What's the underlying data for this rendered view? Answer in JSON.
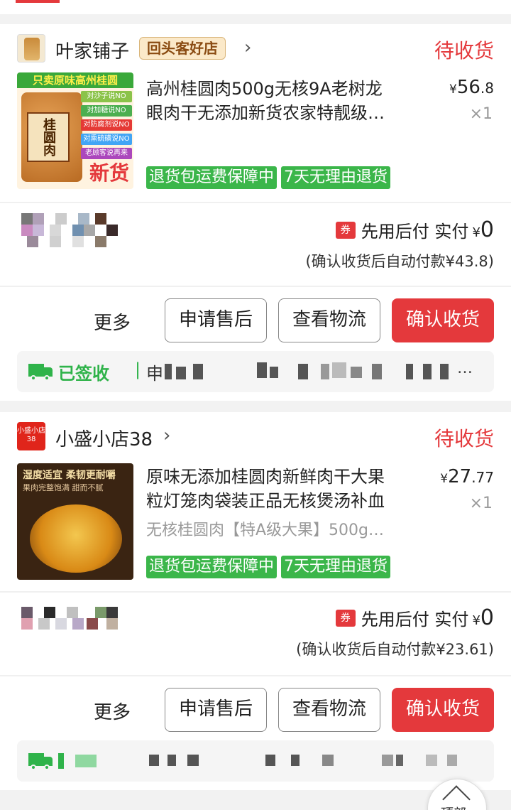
{
  "orders": [
    {
      "shop_name": "叶家铺子",
      "shop_badge": "回头客好店",
      "status": "待收货",
      "thumb_banner": "只卖原味高州桂圆",
      "thumb_jar_label": "桂圆肉",
      "thumb_pills": [
        "对沙子说NO",
        "对加糖说NO",
        "对防腐剂说NO",
        "对熏硫磺说NO",
        "老顾客说再来"
      ],
      "thumb_new_tag": "新货",
      "title_line1": "高州桂圆肉500g无核9A老树龙",
      "title_line2": "眼肉干无添加新货农家特靓级…",
      "price_currency": "¥",
      "price_int": "56",
      "price_dec": ".8",
      "qty": "×1",
      "tags": [
        "退货包运费保障中",
        "7天无理由退货"
      ],
      "coupon": "券",
      "pay_label": "先用后付 实付",
      "pay_currency": "¥",
      "pay_amount": "0",
      "confirm_note": "(确认收货后自动付款¥43.8)",
      "more": "更多",
      "btn_after_sale": "申请售后",
      "btn_logistics": "查看物流",
      "btn_confirm": "确认收货",
      "log_status": "已签收",
      "log_sep": "|",
      "log_text": "申",
      "log_ellipsis": "…"
    },
    {
      "shop_logo_text": "小盛小店 38",
      "shop_name": "小盛小店38",
      "status": "待收货",
      "thumb_text1": "湿度适宜 柔韧更耐嚼",
      "thumb_text2": "果肉完整饱满 甜而不腻",
      "title_line1": "原味无添加桂圆肉新鲜肉干大果",
      "title_line2": "粒灯笼肉袋装正品无核煲汤补血",
      "subtitle": "无核桂圆肉【特A级大果】500g…",
      "price_currency": "¥",
      "price_int": "27",
      "price_dec": ".77",
      "qty": "×1",
      "tags": [
        "退货包运费保障中",
        "7天无理由退货"
      ],
      "coupon": "券",
      "pay_label": "先用后付 实付",
      "pay_currency": "¥",
      "pay_amount": "0",
      "confirm_note": "(确认收货后自动付款¥23.61)",
      "more": "更多",
      "btn_after_sale": "申请售后",
      "btn_logistics": "查看物流",
      "btn_confirm": "确认收货"
    }
  ],
  "back_to_top": "顶部",
  "colors": {
    "accent": "#e4393c",
    "green": "#3bb64a",
    "logistics_green": "#2fb34a"
  }
}
